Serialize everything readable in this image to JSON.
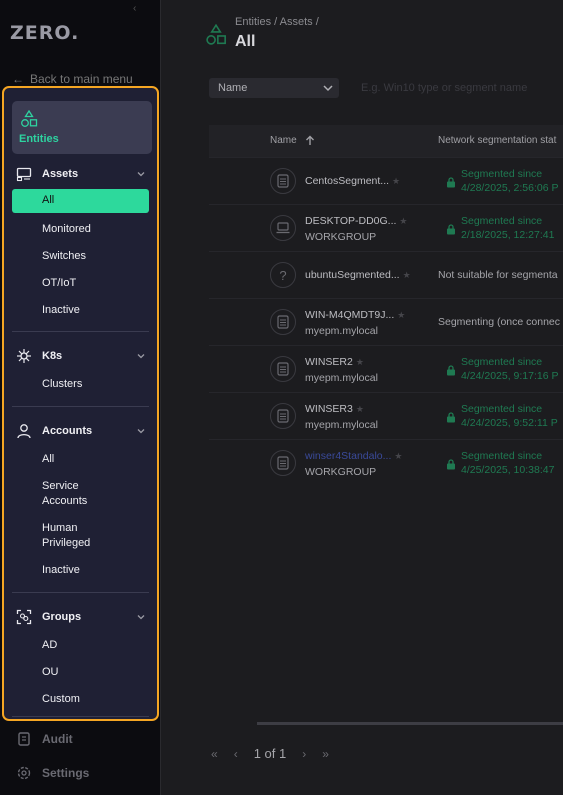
{
  "nav": {
    "logo": "ZERO.",
    "back_label": "Back to main menu",
    "entities_label": "Entities",
    "sections": {
      "assets": {
        "title": "Assets",
        "items": [
          "All",
          "Monitored",
          "Switches",
          "OT/IoT",
          "Inactive"
        ],
        "active": "All"
      },
      "k8s": {
        "title": "K8s",
        "items": [
          "Clusters"
        ]
      },
      "accounts": {
        "title": "Accounts",
        "items": [
          "All",
          "Service Accounts",
          "Human Privileged",
          "Inactive"
        ]
      },
      "groups": {
        "title": "Groups",
        "items": [
          "AD",
          "OU",
          "Custom"
        ]
      }
    },
    "bottom": {
      "audit": "Audit",
      "settings": "Settings"
    }
  },
  "main": {
    "breadcrumb": "Entities / Assets /",
    "title": "All",
    "filter_select": "Name",
    "search_hint": "E.g. Win10 type or segment name",
    "columns": {
      "name": "Name",
      "segmentation": "Network segmentation stat"
    },
    "rows": [
      {
        "name": "CentosSegment...",
        "sub": "",
        "status": "Segmented since",
        "status2": "4/28/2025, 2:56:06 P",
        "ok": true,
        "icon": "server-icon"
      },
      {
        "name": "DESKTOP-DD0G...",
        "sub": "WORKGROUP",
        "status": "Segmented since",
        "status2": "2/18/2025, 12:27:41",
        "ok": true,
        "icon": "laptop-icon"
      },
      {
        "name": "ubuntuSegmented...",
        "sub": "",
        "status": "Not suitable for segmenta",
        "status2": "",
        "ok": false,
        "icon": "unknown-icon"
      },
      {
        "name": "WIN-M4QMDT9J...",
        "sub": "myepm.mylocal",
        "status": "Segmenting (once connec",
        "status2": "",
        "ok": false,
        "icon": "server-icon"
      },
      {
        "name": "WINSER2",
        "sub": "myepm.mylocal",
        "status": "Segmented since",
        "status2": "4/24/2025, 9:17:16 P",
        "ok": true,
        "icon": "server-icon"
      },
      {
        "name": "WINSER3",
        "sub": "myepm.mylocal",
        "status": "Segmented since",
        "status2": "4/24/2025, 9:52:11 P",
        "ok": true,
        "icon": "server-icon"
      },
      {
        "name": "winser4Standalo...",
        "sub": "WORKGROUP",
        "status": "Segmented since",
        "status2": "4/25/2025, 10:38:47",
        "ok": true,
        "icon": "server-icon",
        "link": true
      }
    ],
    "pagination": "1 of 1"
  },
  "colors": {
    "accent": "#2dd99c",
    "highlight_border": "#f5a623",
    "panel_bg": "#1f2034"
  }
}
